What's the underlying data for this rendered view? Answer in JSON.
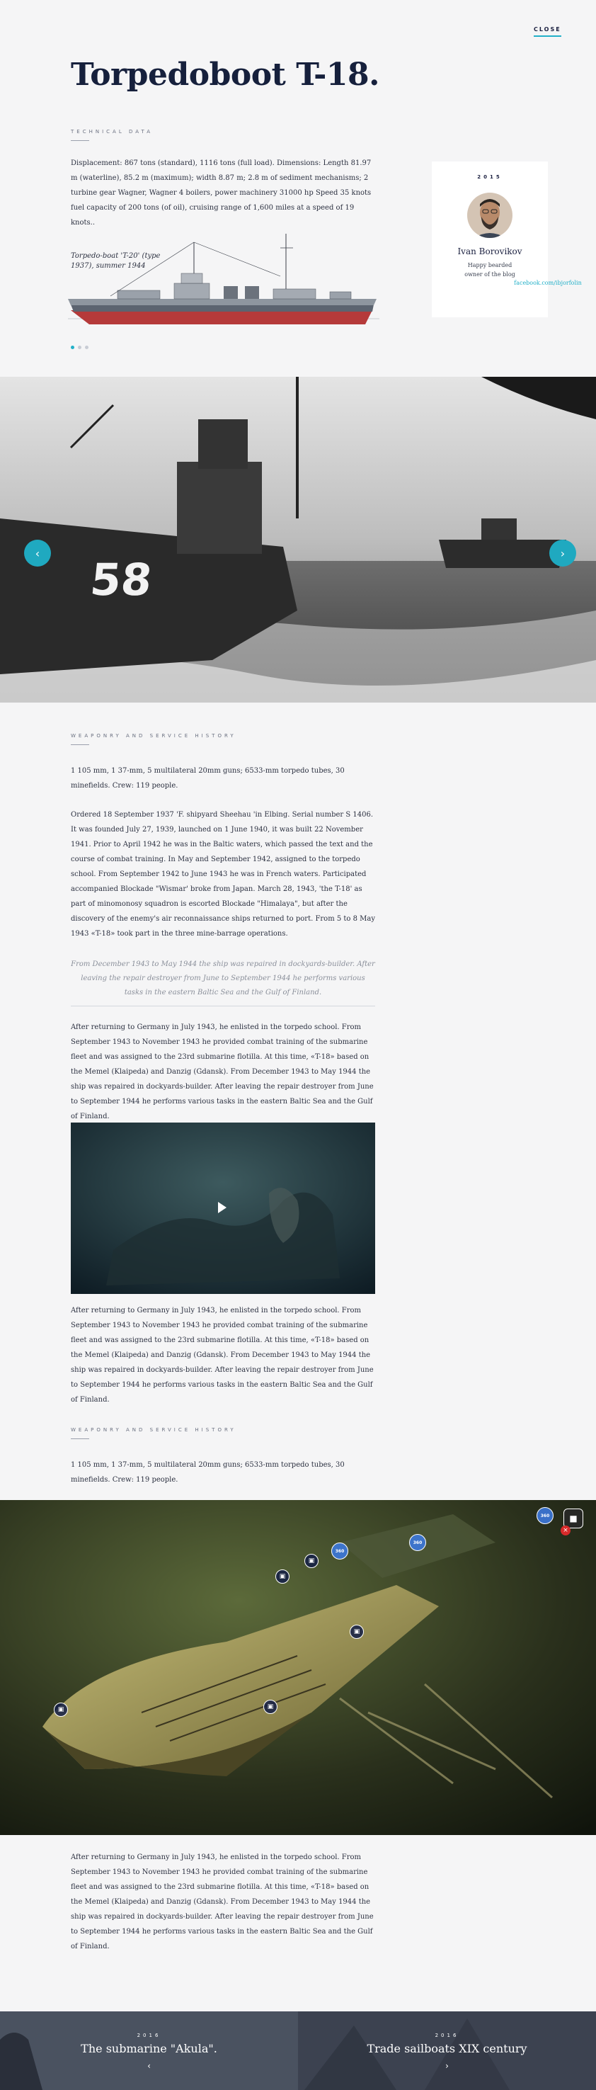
{
  "header": {
    "close_label": "CLOSE",
    "title": "Torpedoboot T-18."
  },
  "technical": {
    "label": "TECHNICAL DATA",
    "text": "Displacement: 867 tons (standard), 1116 tons (full load). Dimensions: Length 81.97 m (waterline), 85.2 m (maximum); width 8.87 m; 2.8 m of sediment mechanisms; 2 turbine gear Wagner, Wagner 4 boilers, power machinery 31000 hp Speed 35 knots fuel capacity of 200 tons (of oil), cruising range of 1,600 miles at a speed of 19 knots..",
    "ship_caption": "Torpedo-boat 'T-20' (type 1937), summer 1944"
  },
  "author": {
    "year": "2015",
    "name": "Ivan Borovikov",
    "desc_line1": "Happy bearded",
    "desc_line2": "owner of the blog",
    "link": "facebook.com/ibjorfolin"
  },
  "history": {
    "label": "WEAPONRY AND SERVICE HISTORY",
    "weapons": "1 105 mm, 1 37-mm, 5 multilateral 20mm guns; 6533-mm torpedo tubes, 30 minefields. Crew: 119 people.",
    "ordered": "Ordered 18 September 1937 'F. shipyard Sheehau 'in Elbing. Serial number S 1406. It was founded July 27, 1939, launched on 1 June 1940, it was built 22 November 1941. Prior to April 1942 he was in the Baltic waters, which passed the text and the course of combat training. In May and September 1942, assigned to the torpedo school. From September 1942 to June 1943 he was in French waters. Participated accompanied Blockade \"Wismar' broke from Japan. March 28, 1943, 'the T-18' as part of minomonosy squadron is escorted Blockade \"Himalaya\", but after the discovery of the enemy's air reconnaissance ships returned to port. From 5 to 8 May 1943 «T-18» took part in the three mine-barrage operations.",
    "quote": "From December 1943 to May 1944 the ship was repaired in dockyards-builder. After leaving the repair destroyer from June to September 1944 he performs various tasks in the eastern Baltic Sea and the Gulf of Finland.",
    "after1": "After returning to Germany in July 1943, he enlisted in the torpedo school. From September 1943 to November 1943 he provided combat training of the submarine fleet and was assigned to the 23rd submarine flotilla. At this time, «T-18» based on the Memel (Klaipeda) and Danzig (Gdansk). From December 1943 to May 1944 the ship was repaired in dockyards-builder. After leaving the repair destroyer from June to September 1944 he performs various tasks in the eastern Baltic Sea and the Gulf of Finland.",
    "after2": "After returning to Germany in July 1943, he enlisted in the torpedo school. From September 1943 to November 1943 he provided combat training of the submarine fleet and was assigned to the 23rd submarine flotilla. At this time, «T-18» based on the Memel (Klaipeda) and Danzig (Gdansk). From December 1943 to May 1944 the ship was repaired in dockyards-builder. After leaving the repair destroyer from June to September 1944 he performs various tasks in the eastern Baltic Sea and the Gulf of Finland.",
    "label2": "WEAPONRY AND SERVICE HISTORY",
    "weapons2": "1 105 mm, 1 37-mm, 5 multilateral 20mm guns; 6533-mm torpedo tubes, 30 minefields. Crew: 119 people.",
    "after3": "After returning to Germany in July 1943, he enlisted in the torpedo school. From September 1943 to November 1943 he provided combat training of the submarine fleet and was assigned to the 23rd submarine flotilla. At this time, «T-18» based on the Memel (Klaipeda) and Danzig (Gdansk). From December 1943 to May 1944 the ship was repaired in dockyards-builder. After leaving the repair destroyer from June to September 1944 he performs various tasks in the eastern Baltic Sea and the Gulf of Finland."
  },
  "photo": {
    "hull_number": "58",
    "prev_icon": "chevron-left-icon",
    "next_icon": "chevron-right-icon"
  },
  "wreck": {
    "label_360": "360"
  },
  "footer": {
    "left_year": "2016",
    "left_title": "The submarine \"Akula\".",
    "left_arrow": "‹",
    "right_year": "2016",
    "right_title": "Trade sailboats XIX century",
    "right_arrow": "›"
  },
  "colors": {
    "accent": "#22b0c8",
    "title": "#16203c"
  }
}
